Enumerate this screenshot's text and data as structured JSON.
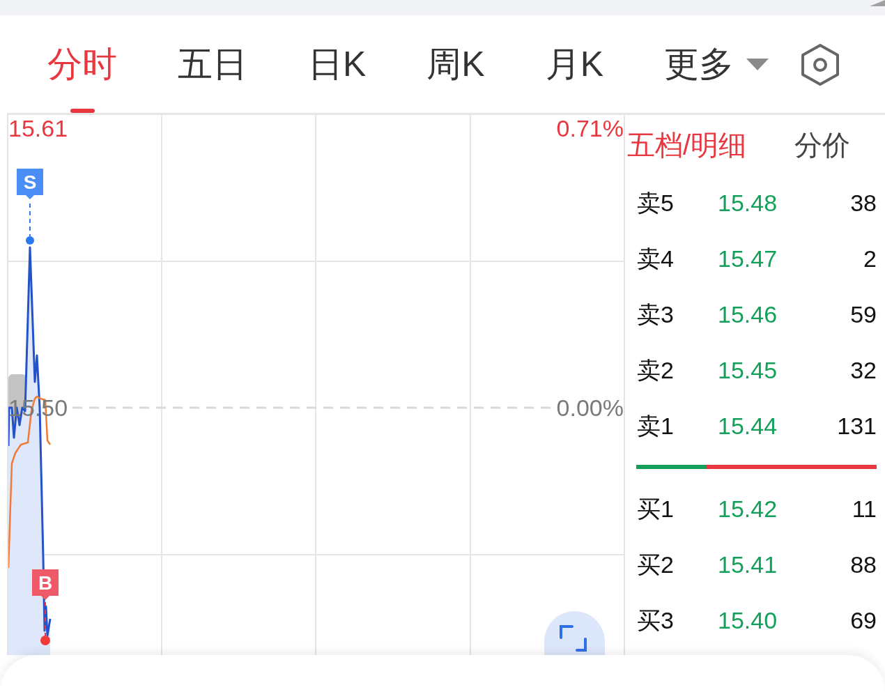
{
  "top_tabs": [
    {
      "label": "分时",
      "selected": true,
      "kind": "tab"
    },
    {
      "label": "五日",
      "selected": false,
      "kind": "tab"
    },
    {
      "label": "日K",
      "selected": false,
      "kind": "tab"
    },
    {
      "label": "周K",
      "selected": false,
      "kind": "tab"
    },
    {
      "label": "月K",
      "selected": false,
      "kind": "tab"
    },
    {
      "label": "更多",
      "selected": false,
      "kind": "dropdown"
    }
  ],
  "chart": {
    "price_high": "15.61",
    "change_high": "0.71%",
    "price_base": "15.50",
    "change_base": "0.00%",
    "trade_markers": [
      {
        "kind": "sell",
        "label": "S"
      },
      {
        "kind": "buy",
        "label": "B"
      }
    ]
  },
  "order_book": {
    "tabs": [
      {
        "label": "五档/明细",
        "selected": true
      },
      {
        "label": "分价",
        "selected": false
      }
    ],
    "asks": [
      {
        "label": "卖5",
        "price": "15.48",
        "volume": "38"
      },
      {
        "label": "卖4",
        "price": "15.47",
        "volume": "2"
      },
      {
        "label": "卖3",
        "price": "15.46",
        "volume": "59"
      },
      {
        "label": "卖2",
        "price": "15.45",
        "volume": "32"
      },
      {
        "label": "卖1",
        "price": "15.44",
        "volume": "131"
      }
    ],
    "ratio_bar": {
      "level": 0.29
    },
    "bids": [
      {
        "label": "买1",
        "price": "15.42",
        "volume": "11"
      },
      {
        "label": "买2",
        "price": "15.41",
        "volume": "88"
      },
      {
        "label": "买3",
        "price": "15.40",
        "volume": "69"
      }
    ]
  }
}
